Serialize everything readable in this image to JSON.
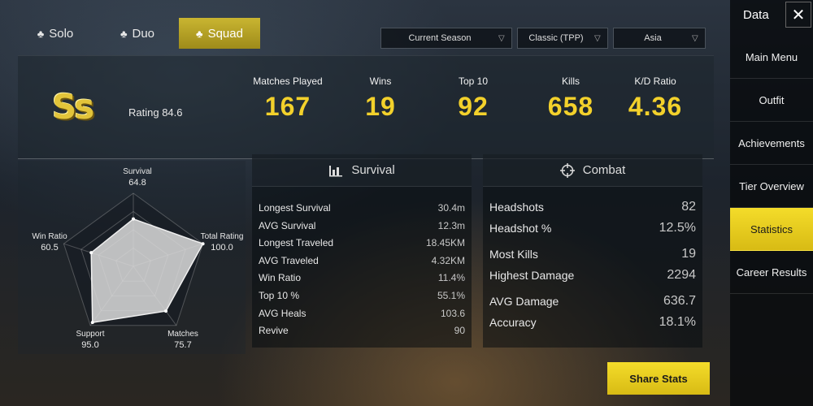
{
  "mode_tabs": [
    {
      "label": "Solo",
      "icon": "solo-person-icon",
      "active": false
    },
    {
      "label": "Duo",
      "icon": "duo-people-icon",
      "active": false
    },
    {
      "label": "Squad",
      "icon": "squad-people-icon",
      "active": true
    }
  ],
  "filters": {
    "season": "Current Season",
    "mode": "Classic (TPP)",
    "region": "Asia"
  },
  "summary": {
    "tier": "Ss",
    "rating": "Rating 84.6",
    "stats": [
      {
        "label": "Matches Played",
        "value": "167"
      },
      {
        "label": "Wins",
        "value": "19"
      },
      {
        "label": "Top 10",
        "value": "92"
      },
      {
        "label": "Kills",
        "value": "658"
      },
      {
        "label": "K/D Ratio",
        "value": "4.36"
      }
    ]
  },
  "radar": {
    "axes": [
      {
        "label": "Survival",
        "value": "64.8",
        "score": 64.8
      },
      {
        "label": "Total Rating",
        "value": "100.0",
        "score": 100.0
      },
      {
        "label": "Matches",
        "value": "75.7",
        "score": 75.7
      },
      {
        "label": "Support",
        "value": "95.0",
        "score": 95.0
      },
      {
        "label": "Win Ratio",
        "value": "60.5",
        "score": 60.5
      }
    ]
  },
  "survival": {
    "title": "Survival",
    "icon": "bar-chart-icon",
    "rows": [
      {
        "k": "Longest Survival",
        "v": "30.4m"
      },
      {
        "k": "AVG Survival",
        "v": "12.3m"
      },
      {
        "k": "Longest Traveled",
        "v": "18.45KM"
      },
      {
        "k": "AVG Traveled",
        "v": "4.32KM"
      },
      {
        "k": "Win Ratio",
        "v": "11.4%"
      },
      {
        "k": "Top 10 %",
        "v": "55.1%"
      },
      {
        "k": "AVG Heals",
        "v": "103.6"
      },
      {
        "k": "Revive",
        "v": "90"
      }
    ]
  },
  "combat": {
    "title": "Combat",
    "icon": "crosshair-icon",
    "rows": [
      {
        "k": "Headshots",
        "v": "82"
      },
      {
        "k": "Headshot %",
        "v": "12.5%"
      },
      {
        "k": "Most Kills",
        "v": "19"
      },
      {
        "k": "Highest Damage",
        "v": "2294"
      },
      {
        "k": "AVG Damage",
        "v": "636.7"
      },
      {
        "k": "Accuracy",
        "v": "18.1%"
      }
    ]
  },
  "share_label": "Share Stats",
  "sidebar": {
    "title": "Data",
    "items": [
      {
        "label": "Main Menu",
        "active": false
      },
      {
        "label": "Outfit",
        "active": false
      },
      {
        "label": "Achievements",
        "active": false
      },
      {
        "label": "Tier Overview",
        "active": false
      },
      {
        "label": "Statistics",
        "active": true
      },
      {
        "label": "Career Results",
        "active": false
      }
    ]
  },
  "colors": {
    "accent": "#f3d12b",
    "active_tab": "#c9b531"
  }
}
